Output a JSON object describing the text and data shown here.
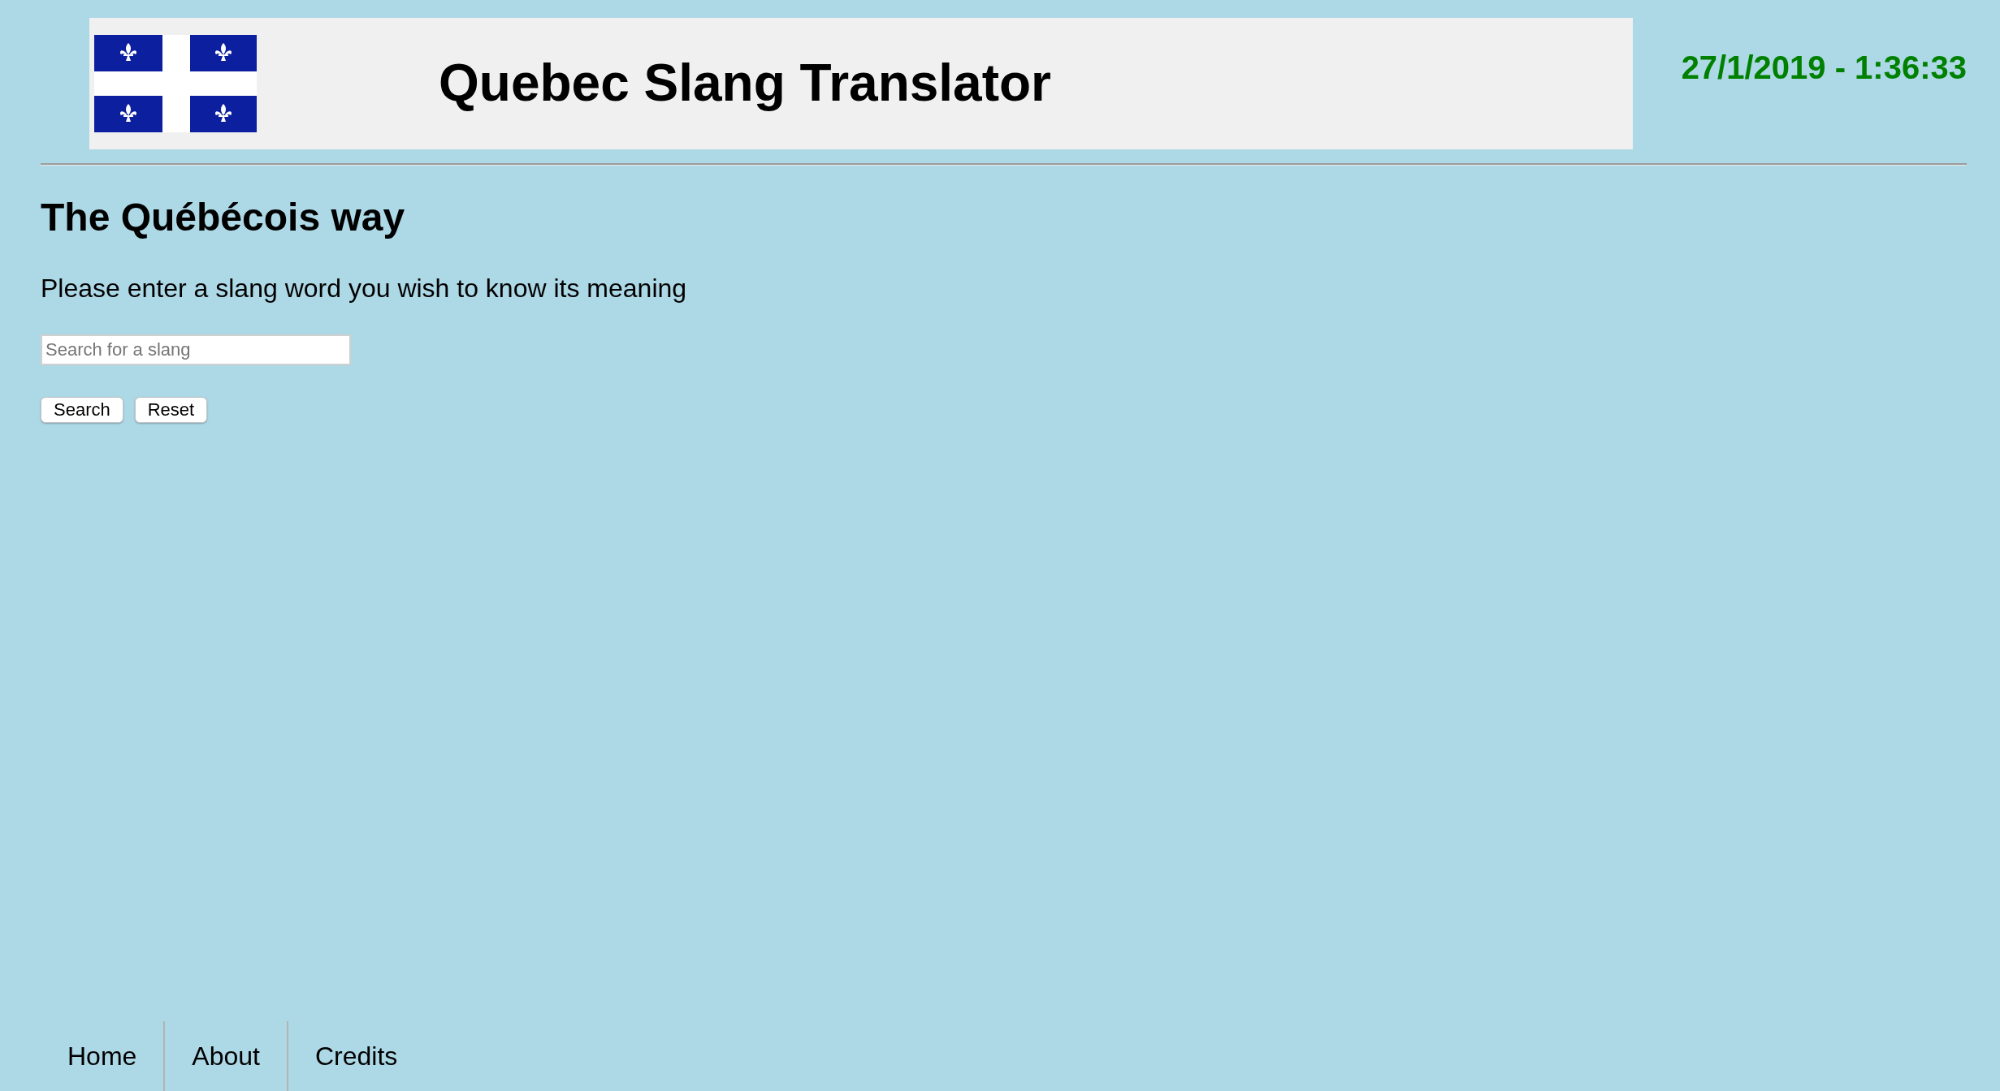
{
  "header": {
    "title": "Quebec Slang Translator",
    "datetime": "27/1/2019 - 1:36:33"
  },
  "main": {
    "heading": "The Québécois way",
    "instruction": "Please enter a slang word you wish to know its meaning",
    "search": {
      "placeholder": "Search for a slang"
    },
    "buttons": [
      "Search",
      "Reset"
    ]
  },
  "nav": {
    "items": [
      {
        "label": "Home",
        "selected": false
      },
      {
        "label": "About",
        "selected": false
      },
      {
        "label": "Credits",
        "selected": false
      }
    ]
  }
}
